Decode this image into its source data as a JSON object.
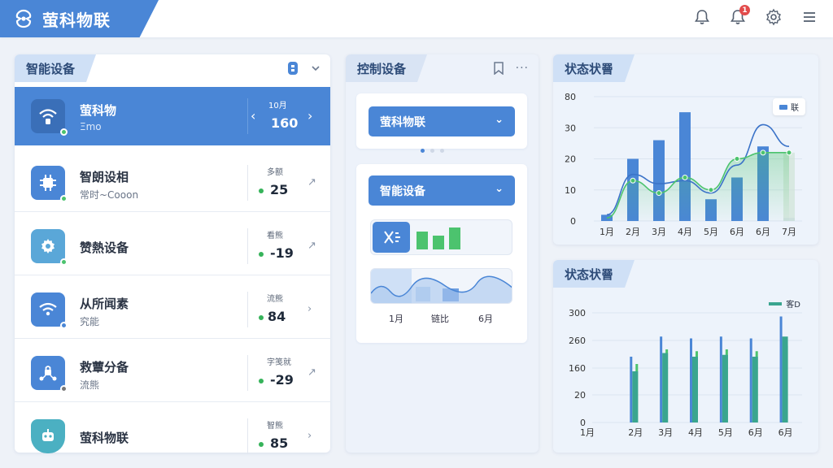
{
  "app": {
    "title": "萤科物联"
  },
  "topbar": {
    "icons": [
      "bell-icon",
      "notification-bell-icon",
      "settings-icon",
      "menu-icon"
    ],
    "notification_count": "1"
  },
  "left_panel": {
    "title": "智能设备",
    "devices": [
      {
        "name": "萤科物",
        "sub": "Ξmo",
        "stat_label": "10月",
        "value": "160",
        "active": true
      },
      {
        "name": "智朗设相",
        "sub": "常时~Cooon",
        "stat_label": "多额",
        "value": "25"
      },
      {
        "name": "赞熱设备",
        "sub": "",
        "stat_label": "看熊",
        "value": "-19"
      },
      {
        "name": "从所闻素",
        "sub": "究能",
        "stat_label": "流熊",
        "value": "84"
      },
      {
        "name": "救蕈分备",
        "sub": "流熊",
        "stat_label": "字笺就",
        "value": "-29"
      },
      {
        "name": "萤科物联",
        "sub": "",
        "stat_label": "智熊",
        "value": "85"
      }
    ]
  },
  "middle_panel": {
    "title": "控制设备",
    "select1": "萤科物联",
    "select2": "智能设备",
    "axis_labels": [
      "1月",
      "链比",
      "6月"
    ]
  },
  "chart1": {
    "title": "状态状罾",
    "legend_label": "联"
  },
  "chart2": {
    "title": "状态状罾",
    "legend_label": "客D"
  },
  "chart_data": [
    {
      "type": "bar",
      "categories": [
        "1月",
        "2月",
        "3月",
        "4月",
        "5月",
        "6月",
        "6月",
        "7月"
      ],
      "yticks": [
        "0",
        "10",
        "20",
        "30",
        "80"
      ],
      "ylim": [
        0,
        40
      ],
      "series": [
        {
          "values": [
            2,
            20,
            26,
            35,
            7,
            14,
            24
          ]
        },
        {
          "values": [
            2,
            15,
            12,
            13,
            9,
            18,
            31,
            24
          ]
        },
        {
          "values": [
            1,
            13,
            9,
            14,
            10,
            20,
            22,
            22
          ]
        }
      ],
      "colors": {
        "bars": "#4a86d6",
        "line_blue": "#3b73c8",
        "line_green": "#4cc36e"
      }
    },
    {
      "type": "bar",
      "categories": [
        "1月",
        "2月",
        "3月",
        "4月",
        "5月",
        "6月",
        "6月"
      ],
      "yticks": [
        "0",
        "20",
        "160",
        "260",
        "300"
      ],
      "series": [
        {
          "values": [
            180,
            235,
            230,
            235,
            230,
            290
          ]
        },
        {
          "values": [
            160,
            200,
            195,
            200,
            195,
            210
          ]
        },
        {
          "values": [
            140,
            190,
            180,
            185,
            180,
            235
          ]
        }
      ]
    }
  ]
}
